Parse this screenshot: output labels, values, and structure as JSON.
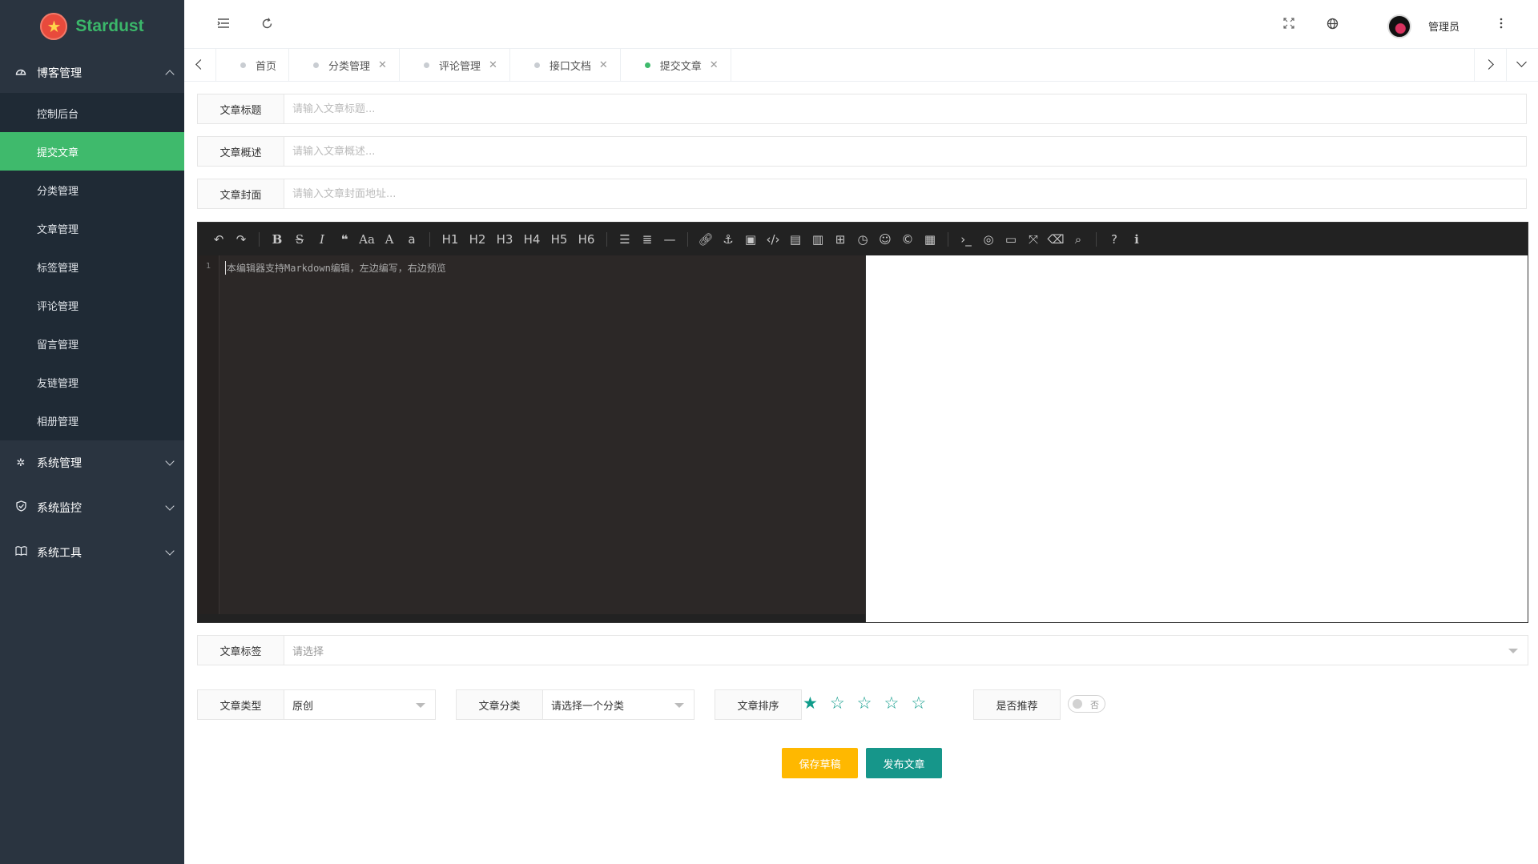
{
  "brand": {
    "name": "Stardust",
    "logo_icon": "star-badge-icon"
  },
  "sidebar": {
    "group_blog": {
      "label": "博客管理",
      "icon": "dashboard-icon"
    },
    "items": [
      {
        "label": "控制后台"
      },
      {
        "label": "提交文章",
        "active": true
      },
      {
        "label": "分类管理"
      },
      {
        "label": "文章管理"
      },
      {
        "label": "标签管理"
      },
      {
        "label": "评论管理"
      },
      {
        "label": "留言管理"
      },
      {
        "label": "友链管理"
      },
      {
        "label": "相册管理"
      }
    ],
    "group_system": {
      "label": "系统管理",
      "icon": "gear-icon"
    },
    "group_monitor": {
      "label": "系统监控",
      "icon": "shield-icon"
    },
    "group_tools": {
      "label": "系统工具",
      "icon": "book-icon"
    }
  },
  "header": {
    "user_name": "管理员",
    "icons": [
      "menu-toggle-icon",
      "refresh-icon",
      "fullscreen-icon",
      "globe-icon",
      "more-icon"
    ]
  },
  "tabs": [
    {
      "label": "首页",
      "closable": false
    },
    {
      "label": "分类管理",
      "closable": true
    },
    {
      "label": "评论管理",
      "closable": true
    },
    {
      "label": "接口文档",
      "closable": true
    },
    {
      "label": "提交文章",
      "closable": true,
      "active": true
    }
  ],
  "form": {
    "title": {
      "label": "文章标题",
      "placeholder": "请输入文章标题..."
    },
    "summary": {
      "label": "文章概述",
      "placeholder": "请输入文章概述..."
    },
    "cover": {
      "label": "文章封面",
      "placeholder": "请输入文章封面地址..."
    },
    "editor": {
      "line_number": "1",
      "content": "本编辑器支持Markdown编辑，左边编写，右边预览",
      "toolbar_headings": [
        "H1",
        "H2",
        "H3",
        "H4",
        "H5",
        "H6"
      ]
    },
    "tags": {
      "label": "文章标签",
      "placeholder": "请选择"
    },
    "type": {
      "label": "文章类型",
      "value": "原创"
    },
    "category": {
      "label": "文章分类",
      "value": "请选择一个分类"
    },
    "sort": {
      "label": "文章排序",
      "rating": 1,
      "max": 5
    },
    "recommend": {
      "label": "是否推荐",
      "value": "否"
    },
    "buttons": {
      "draft": "保存草稿",
      "publish": "发布文章"
    }
  },
  "colors": {
    "sidebar_bg": "#2a3440",
    "accent": "#3fba6c",
    "draft": "#ffb800",
    "publish": "#16968a"
  }
}
